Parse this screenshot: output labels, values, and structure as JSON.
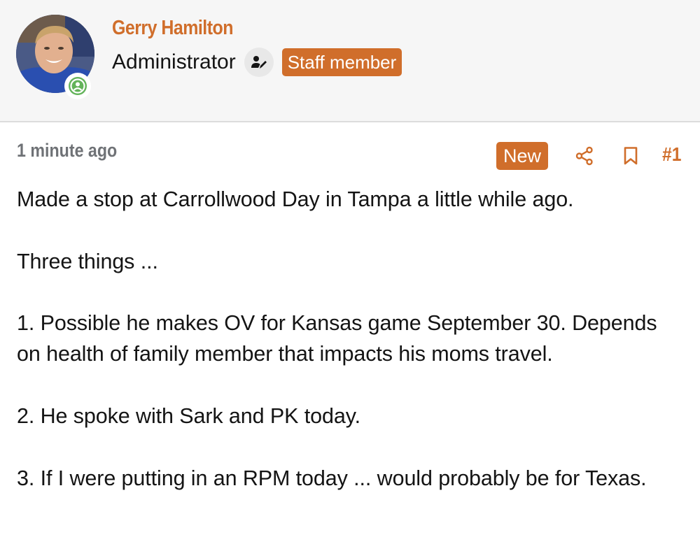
{
  "user": {
    "name": "Gerry Hamilton",
    "title": "Administrator",
    "badge": "Staff member",
    "avatar_icon": "user-photo",
    "status_icon": "online-user-icon",
    "role_icon": "user-edit-icon"
  },
  "post": {
    "time": "1 minute ago",
    "new_label": "New",
    "number": "#1",
    "share_icon": "share-icon",
    "bookmark_icon": "bookmark-icon",
    "paragraphs": [
      "Made a stop at Carrollwood Day in Tampa a little while ago.",
      "Three things ...",
      "1. Possible he makes OV for Kansas game September 30. Depends on health of family member that impacts his moms travel.",
      "2. He spoke with Sark and PK today.",
      "3. If I were putting in an RPM today ... would probably be for Texas."
    ]
  },
  "colors": {
    "accent": "#d06e2b",
    "header_bg": "#f6f6f6",
    "online_green": "#63b35a",
    "muted_text": "#6f7276"
  }
}
